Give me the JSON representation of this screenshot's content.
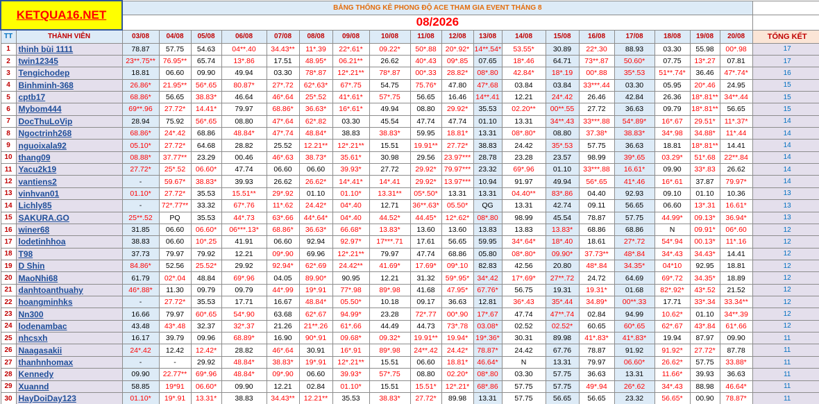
{
  "logo": "KETQUA16.NET",
  "subtitle": "BẢNG THỐNG KÊ PHONG ĐỘ ACE THAM GIA EVENT THÁNG 8",
  "month": "08/2026",
  "headers": {
    "tt": "TT",
    "member": "THÀNH VIÊN",
    "dates": [
      "03/08",
      "04/08",
      "05/08",
      "06/08",
      "07/08",
      "08/08",
      "09/08",
      "10/08",
      "11/08",
      "12/08",
      "13/08",
      "14/08",
      "15/08",
      "16/08",
      "17/08",
      "18/08",
      "19/08",
      "20/08"
    ],
    "total": "TỔNG KẾT"
  },
  "rows": [
    {
      "tt": "1",
      "name": "thinh bùi 1111",
      "cells": [
        "78.87",
        "57.75",
        "54.63",
        "04**.40",
        "34.43**",
        "11*.39",
        "22*.61*",
        "09.22*",
        "50*.88",
        "20*.92*",
        "14**.54*",
        "53.55*",
        "30.89",
        "22*.30",
        "88.93",
        "03.30",
        "55.98",
        "00*.98"
      ],
      "total": "17"
    },
    {
      "tt": "2",
      "name": "twin12345",
      "cells": [
        "23**.75**",
        "76.95**",
        "65.74",
        "13*.86",
        "17.51",
        "48.95*",
        "06.21**",
        "26.62",
        "40*.43",
        "09*.85",
        "07.65",
        "18*.46",
        "64.71",
        "73**.87",
        "50.60*",
        "07.75",
        "13*.27",
        "07.81"
      ],
      "total": "17"
    },
    {
      "tt": "3",
      "name": "Tengichodep",
      "cells": [
        "18.81",
        "06.60",
        "09.90",
        "49.94",
        "03.30",
        "78*.87",
        "12*.21**",
        "78*.87",
        "00*.33",
        "28.82*",
        "08*.80",
        "42.84*",
        "18*.19",
        "00*.88",
        "35*.53",
        "51**.74*",
        "36.46",
        "47*.74*"
      ],
      "total": "16"
    },
    {
      "tt": "4",
      "name": "Binhminh-368",
      "cells": [
        "26.86*",
        "21.95**",
        "56*.65",
        "80.87*",
        "27*.72",
        "62*.63*",
        "67*.75",
        "54.75",
        "75.76*",
        "47.80",
        "47*.68",
        "03.84",
        "03.84",
        "33***.44",
        "03.30",
        "05.95",
        "20*.46",
        "24.95"
      ],
      "total": "15"
    },
    {
      "tt": "5",
      "name": "cptb17",
      "cells": [
        "68.86*",
        "56.65",
        "38.83*",
        "46.64",
        "46*.64",
        "25*.52",
        "41*.61*",
        "57*.75",
        "56.65",
        "16.46",
        "14**.41",
        "12.21",
        "24*.42",
        "26.46",
        "42.84",
        "26.36",
        "18*.81**",
        "34**.44"
      ],
      "total": "15"
    },
    {
      "tt": "6",
      "name": "Mybom444",
      "cells": [
        "69**.96",
        "27.72*",
        "14.41*",
        "79.97",
        "68.86*",
        "36.63*",
        "16*.61*",
        "49.94",
        "08.80",
        "29.92*",
        "35.53",
        "02.20**",
        "00**.55",
        "27.72",
        "36.63",
        "09.79",
        "18*.81**",
        "56.65"
      ],
      "total": "15"
    },
    {
      "tt": "7",
      "name": "DocThuLoVip",
      "cells": [
        "28.94",
        "75.92",
        "56*.65",
        "08.80",
        "47*.64",
        "62*.82",
        "03.30",
        "45.54",
        "47.74",
        "47.74",
        "01.10",
        "13.31",
        "34**.43",
        "33***.88",
        "54*.89*",
        "16*.67",
        "29.51*",
        "11*.37*"
      ],
      "total": "14"
    },
    {
      "tt": "8",
      "name": "Ngoctrinh268",
      "cells": [
        "68.86*",
        "24*.42",
        "68.86",
        "48.84*",
        "47*.74",
        "48.84*",
        "38.83",
        "38.83*",
        "59.95",
        "18.81*",
        "13.31",
        "08*.80*",
        "08.80",
        "37.38*",
        "38.83*",
        "34*.98",
        "34.88*",
        "11*.44"
      ],
      "total": "14"
    },
    {
      "tt": "9",
      "name": "nguoixala92",
      "cells": [
        "05.10*",
        "27.72*",
        "64.68",
        "28.82",
        "25.52",
        "12.21**",
        "12*.21**",
        "15.51",
        "19.91**",
        "27.72*",
        "38.83",
        "24.42",
        "35*.53",
        "57.75",
        "36.63",
        "18.81",
        "18*.81**",
        "14.41"
      ],
      "total": "14"
    },
    {
      "tt": "10",
      "name": "thang09",
      "cells": [
        "08.88*",
        "37.77**",
        "23.29",
        "00.46",
        "46*.63",
        "38.73*",
        "35.61*",
        "30.98",
        "29.56",
        "23.97***",
        "28.78",
        "23.28",
        "23.57",
        "98.99",
        "39*.65",
        "03.29*",
        "51*.68",
        "22**.84"
      ],
      "total": "14"
    },
    {
      "tt": "11",
      "name": "Yacu2k19",
      "cells": [
        "27.72*",
        "25*.52",
        "06.60*",
        "47.74",
        "06.60",
        "06.60",
        "39.93*",
        "27.72",
        "29.92*",
        "79.97***",
        "23.32",
        "69*.96",
        "01.10",
        "33***.88",
        "16.61*",
        "09.90",
        "33*.83",
        "26.62"
      ],
      "total": "14"
    },
    {
      "tt": "12",
      "name": "vantiens2",
      "cells": [
        "-",
        "59.67*",
        "38.83*",
        "39.93",
        "26.62",
        "26.62*",
        "14*.41*",
        "14*.41",
        "29.92*",
        "13.97***",
        "10.94",
        "91.97",
        "49.94",
        "56*.65",
        "41*.46",
        "16*.61",
        "37.87",
        "79.97*"
      ],
      "total": "14"
    },
    {
      "tt": "13",
      "name": "vinhvan01",
      "cells": [
        "01.10*",
        "27.72*",
        "35.53",
        "15.51**",
        "29*.92",
        "01.10",
        "01.10*",
        "13.31**",
        "05*.50*",
        "13.31",
        "13.31",
        "04.40**",
        "83*.86",
        "04.40",
        "92.93",
        "09.10",
        "01.10",
        "10.36"
      ],
      "total": "13"
    },
    {
      "tt": "14",
      "name": "Lichly85",
      "cells": [
        "-",
        "72*.77**",
        "33.32",
        "67*.76",
        "11*.62",
        "24.42*",
        "04*.40",
        "12.71",
        "36**.63*",
        "05.50*",
        "QG",
        "13.31",
        "42.74",
        "09.11",
        "56.65",
        "06.60",
        "13*.31",
        "16.61*"
      ],
      "total": "13"
    },
    {
      "tt": "15",
      "name": "SAKURA.GO",
      "cells": [
        "25**.52",
        "PQ",
        "35.53",
        "44*.73",
        "63*.66",
        "44*.64*",
        "04*.40",
        "44.52*",
        "44.45*",
        "12*.62*",
        "08*.80",
        "98.99",
        "45.54",
        "78.87",
        "57.75",
        "44.99*",
        "09.13*",
        "36.94*"
      ],
      "total": "13"
    },
    {
      "tt": "16",
      "name": "winer68",
      "cells": [
        "31.85",
        "06.60",
        "06.60*",
        "06***.13*",
        "68.86*",
        "36.63*",
        "66.68*",
        "13.83*",
        "13.60",
        "13.60",
        "13.83",
        "13.83",
        "13.83*",
        "68.86",
        "68.86",
        "N",
        "09.91*",
        "06*.60"
      ],
      "total": "12"
    },
    {
      "tt": "17",
      "name": "lodetinhhoa",
      "cells": [
        "38.83",
        "06.60",
        "10*.25",
        "41.91",
        "06.60",
        "92.94",
        "92.97*",
        "17***.71",
        "17.61",
        "56.65",
        "59.95",
        "34*.64*",
        "18*.40",
        "18.61",
        "27*.72",
        "54*.94",
        "00.13*",
        "11*.16"
      ],
      "total": "12"
    },
    {
      "tt": "18",
      "name": "T98",
      "cells": [
        "37.73",
        "79.97",
        "79.92",
        "12.21",
        "09*.90",
        "69.96",
        "12*.21**",
        "79.97",
        "47.74",
        "68.86",
        "05.80",
        "08*.80*",
        "09.90*",
        "37.73**",
        "48*.84",
        "34*.43",
        "34.43*",
        "14.41"
      ],
      "total": "12"
    },
    {
      "tt": "19",
      "name": "D Shin",
      "cells": [
        "84.86*",
        "52.56",
        "25.52*",
        "29.92",
        "92.94*",
        "62*.69",
        "24.42**",
        "41.69*",
        "17.69*",
        "09*.10",
        "82.83",
        "42.56",
        "20.80",
        "48*.84",
        "34.35*",
        "04*10",
        "92.95",
        "18.81"
      ],
      "total": "12"
    },
    {
      "tt": "20",
      "name": "MaoNhi68",
      "cells": [
        "61.79",
        "02*.04",
        "48.84",
        "69*.96",
        "04.05",
        "89.90*",
        "90.95",
        "12.21",
        "31.32",
        "59*.95*",
        "34*.42",
        "17*.69*",
        "27**.72",
        "24.72",
        "64.69",
        "69*.72",
        "34.35*",
        "18.89"
      ],
      "total": "12"
    },
    {
      "tt": "21",
      "name": "danhtoanthuahy",
      "cells": [
        "46*.88*",
        "11.30",
        "09.79",
        "09.79",
        "44*.99",
        "19*.91",
        "77*.98",
        "89*.98",
        "41.68",
        "47.95*",
        "67.76*",
        "56.75",
        "19.31",
        "19.31*",
        "01.68",
        "82*.92*",
        "43*.52",
        "21.52"
      ],
      "total": "12"
    },
    {
      "tt": "22",
      "name": "hoangminhks",
      "cells": [
        "-",
        "27.72*",
        "35.53",
        "17.71",
        "16.67",
        "48.84*",
        "05.50*",
        "10.18",
        "09.17",
        "36.63",
        "12.81",
        "36*.43",
        "35*.44",
        "34.89*",
        "00**.33",
        "17.71",
        "33*.34",
        "33.34**"
      ],
      "total": "12"
    },
    {
      "tt": "23",
      "name": "Nn300",
      "cells": [
        "16.66",
        "79.97",
        "60*.65",
        "54*.90",
        "63.68",
        "62*.67",
        "94.99*",
        "23.28",
        "72*.77",
        "00*.90",
        "17*.67",
        "47.74",
        "47**.74",
        "02.84",
        "94.99",
        "10.62*",
        "01.10",
        "34**.39"
      ],
      "total": "12"
    },
    {
      "tt": "24",
      "name": "lodenambac",
      "cells": [
        "43.48",
        "43*.48",
        "32.37",
        "32*.37",
        "21.26",
        "21**.26",
        "61*.66",
        "44.49",
        "44.73",
        "73*.78",
        "03.08*",
        "02.52",
        "02.52*",
        "60.65",
        "60*.65",
        "62*.67",
        "43*.84",
        "61*.66"
      ],
      "total": "12"
    },
    {
      "tt": "25",
      "name": "nhcsxh",
      "cells": [
        "16.17",
        "39.79",
        "09.96",
        "68.89*",
        "16.90",
        "90*.91",
        "09.68*",
        "09.32*",
        "19.91**",
        "19.94*",
        "19*.36*",
        "30.31",
        "89.98",
        "41*.83*",
        "41*.83*",
        "19.94",
        "87.97",
        "09.90"
      ],
      "total": "11"
    },
    {
      "tt": "26",
      "name": "Naagasakii",
      "cells": [
        "24*.42",
        "12.42",
        "12.42*",
        "28.82",
        "46*.64",
        "30.91",
        "16*.91",
        "89*.98",
        "24**.42",
        "24.42*",
        "78.87*",
        "24.42",
        "67.76",
        "78.87",
        "91.92",
        "91.92*",
        "27.72*",
        "87.78"
      ],
      "total": "11"
    },
    {
      "tt": "27",
      "name": "thanhnhomax",
      "cells": [
        "-",
        "-",
        "29.92",
        "48.84*",
        "38.83*",
        "19*.91",
        "12*.21**",
        "15.51",
        "06.60",
        "18.81*",
        "46.64*",
        "N",
        "13.31",
        "79.97",
        "06.60*",
        "26.62*",
        "57.75",
        "33.88*"
      ],
      "total": "11"
    },
    {
      "tt": "28",
      "name": "Kennedy",
      "cells": [
        "09.90",
        "22.77**",
        "69*.96",
        "48.84*",
        "09*.90",
        "06.60",
        "39.93*",
        "57*.75",
        "08.80",
        "02.20*",
        "08*.80",
        "03.30",
        "57.75",
        "36.63",
        "13.31",
        "11.66*",
        "39.93",
        "36.63"
      ],
      "total": "11"
    },
    {
      "tt": "29",
      "name": "Xuannd",
      "cells": [
        "58.85",
        "19*91",
        "06.60*",
        "09.90",
        "12.21",
        "02.84",
        "01.10*",
        "15.51",
        "15.51*",
        "12*.21*",
        "68*.86",
        "57.75",
        "57.75",
        "49*.94",
        "26*.62",
        "34*.43",
        "88.98",
        "46.64*"
      ],
      "total": "11"
    },
    {
      "tt": "30",
      "name": "HayDoiDay123",
      "cells": [
        "01.10*",
        "19*.91",
        "13.31*",
        "38.83",
        "34.43**",
        "12.21**",
        "35.53",
        "38.83*",
        "27.72*",
        "89.98",
        "13.31",
        "57.75",
        "56.65",
        "56.65",
        "23.32",
        "56.65*",
        "00.90",
        "78.87*"
      ],
      "total": "11"
    }
  ],
  "colors": {
    "red_text": "#ff0000",
    "member_bg": "#e4dfec",
    "header_bg": "#ddebf7",
    "logo_bg": "#ffff00",
    "total_text": "#0070c0"
  }
}
